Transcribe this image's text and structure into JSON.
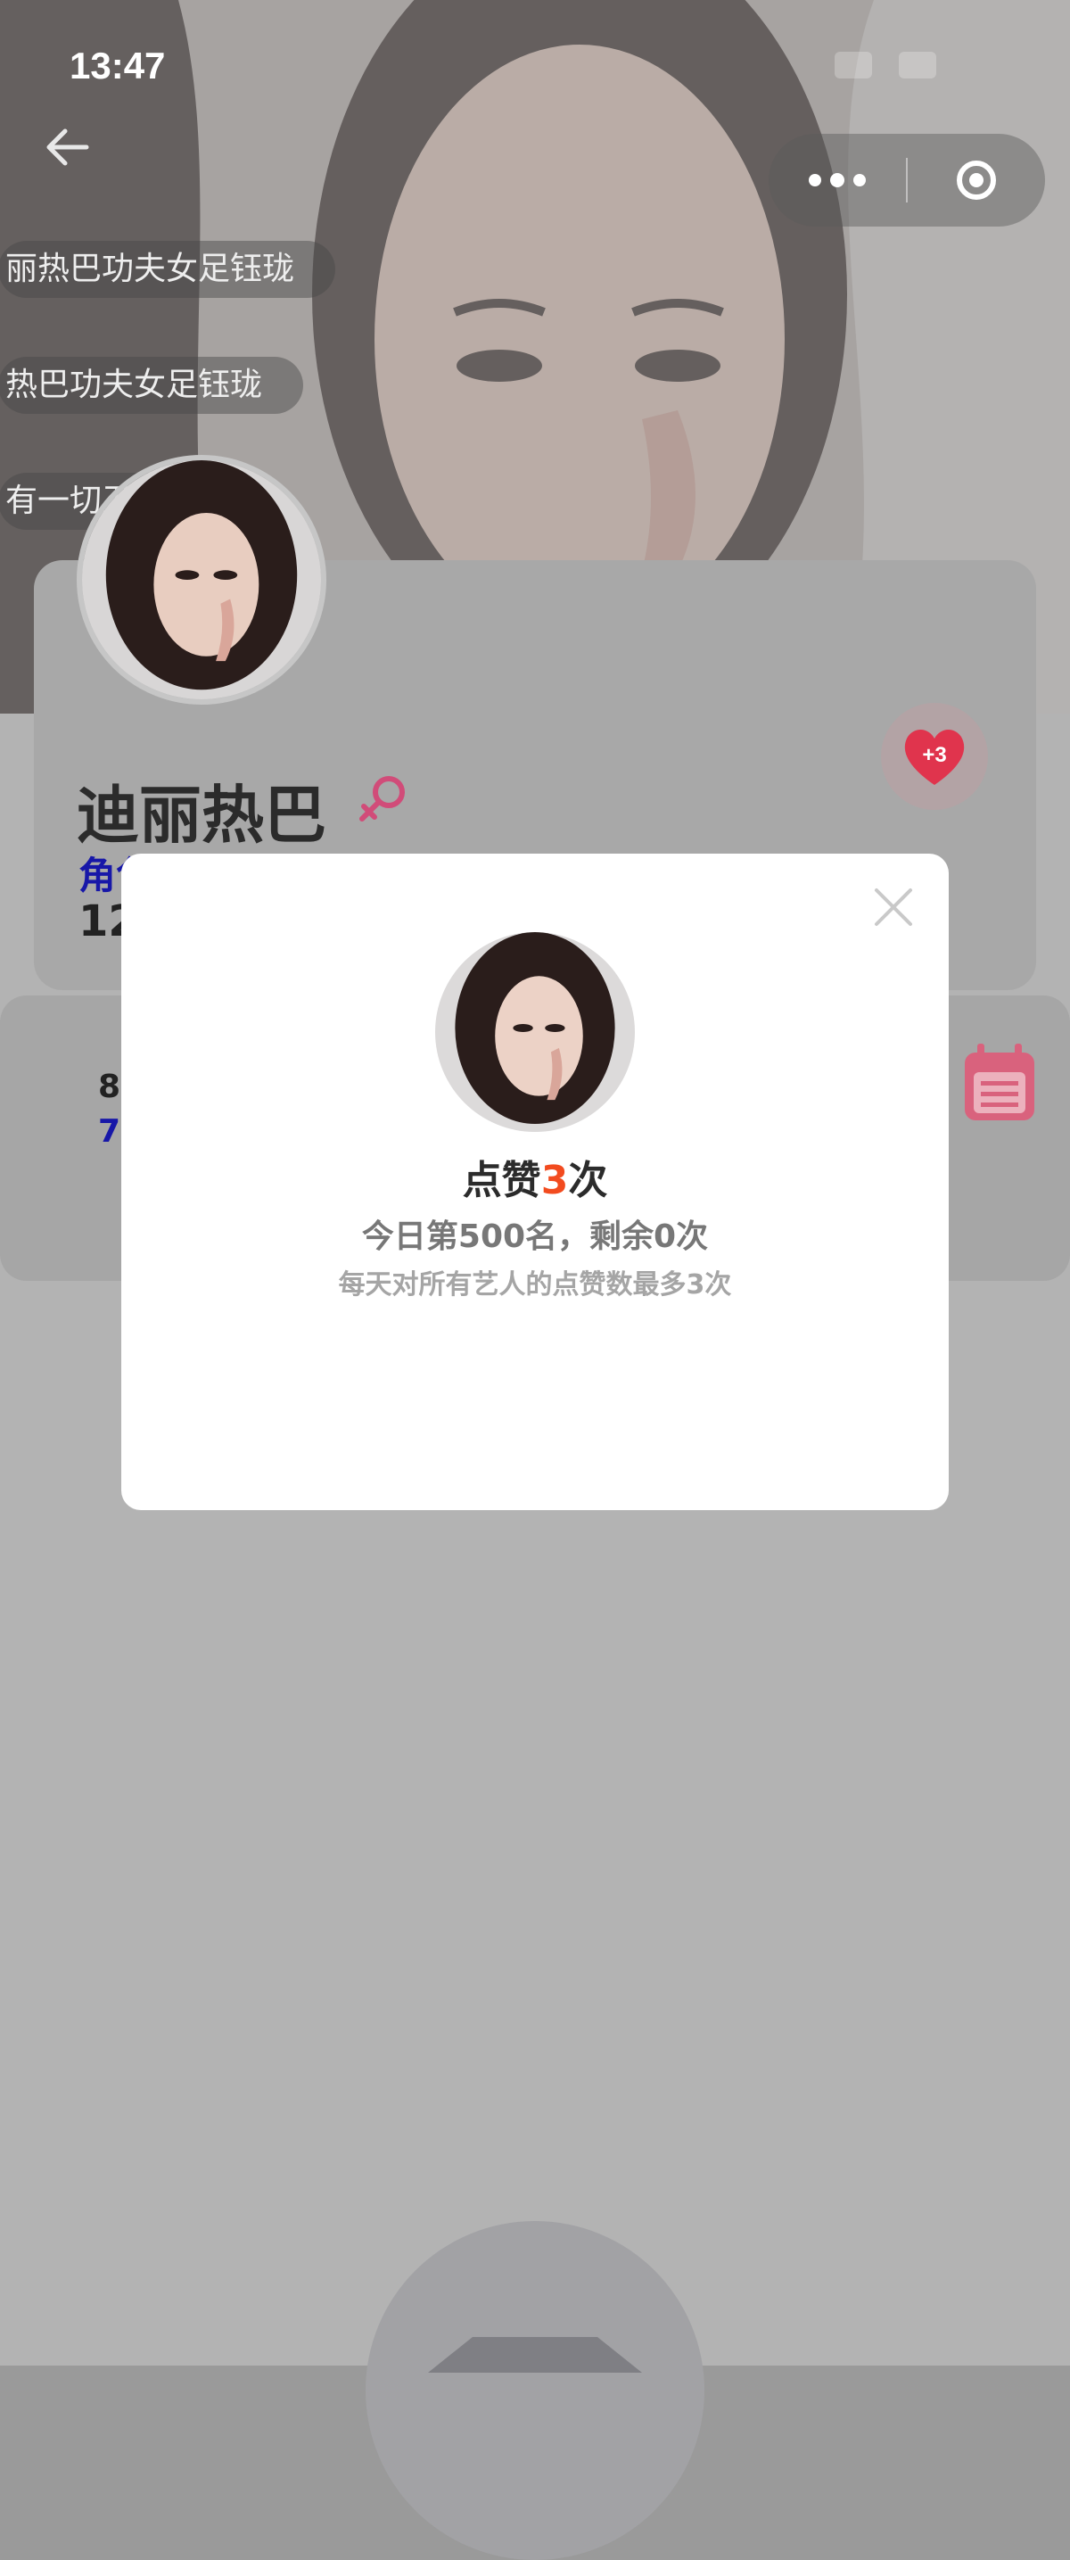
{
  "status_bar": {
    "time": "13:47"
  },
  "danmaku": [
    "丽热巴功夫女足钰珑",
    "热巴功夫女足钰珑",
    "有一切卫"
  ],
  "profile": {
    "name": "迪丽热巴",
    "role_link": "角色类型",
    "count_partial": "12",
    "like_badge": "+3"
  },
  "stats": {
    "line1": "8",
    "line2": "7"
  },
  "modal": {
    "title_prefix": "点赞",
    "title_count": "3",
    "title_suffix": "次",
    "rank_text": "今日第500名，剩余0次",
    "note_text": "每天对所有艺人的点赞数最多3次"
  },
  "colors": {
    "accent_orange": "#f24b1f",
    "heart_red": "#e0344d",
    "link_blue": "#1717a8"
  },
  "icons": [
    "back-arrow-icon",
    "more-dots-icon",
    "target-icon",
    "female-icon",
    "heart-icon",
    "calendar-icon",
    "close-icon"
  ]
}
